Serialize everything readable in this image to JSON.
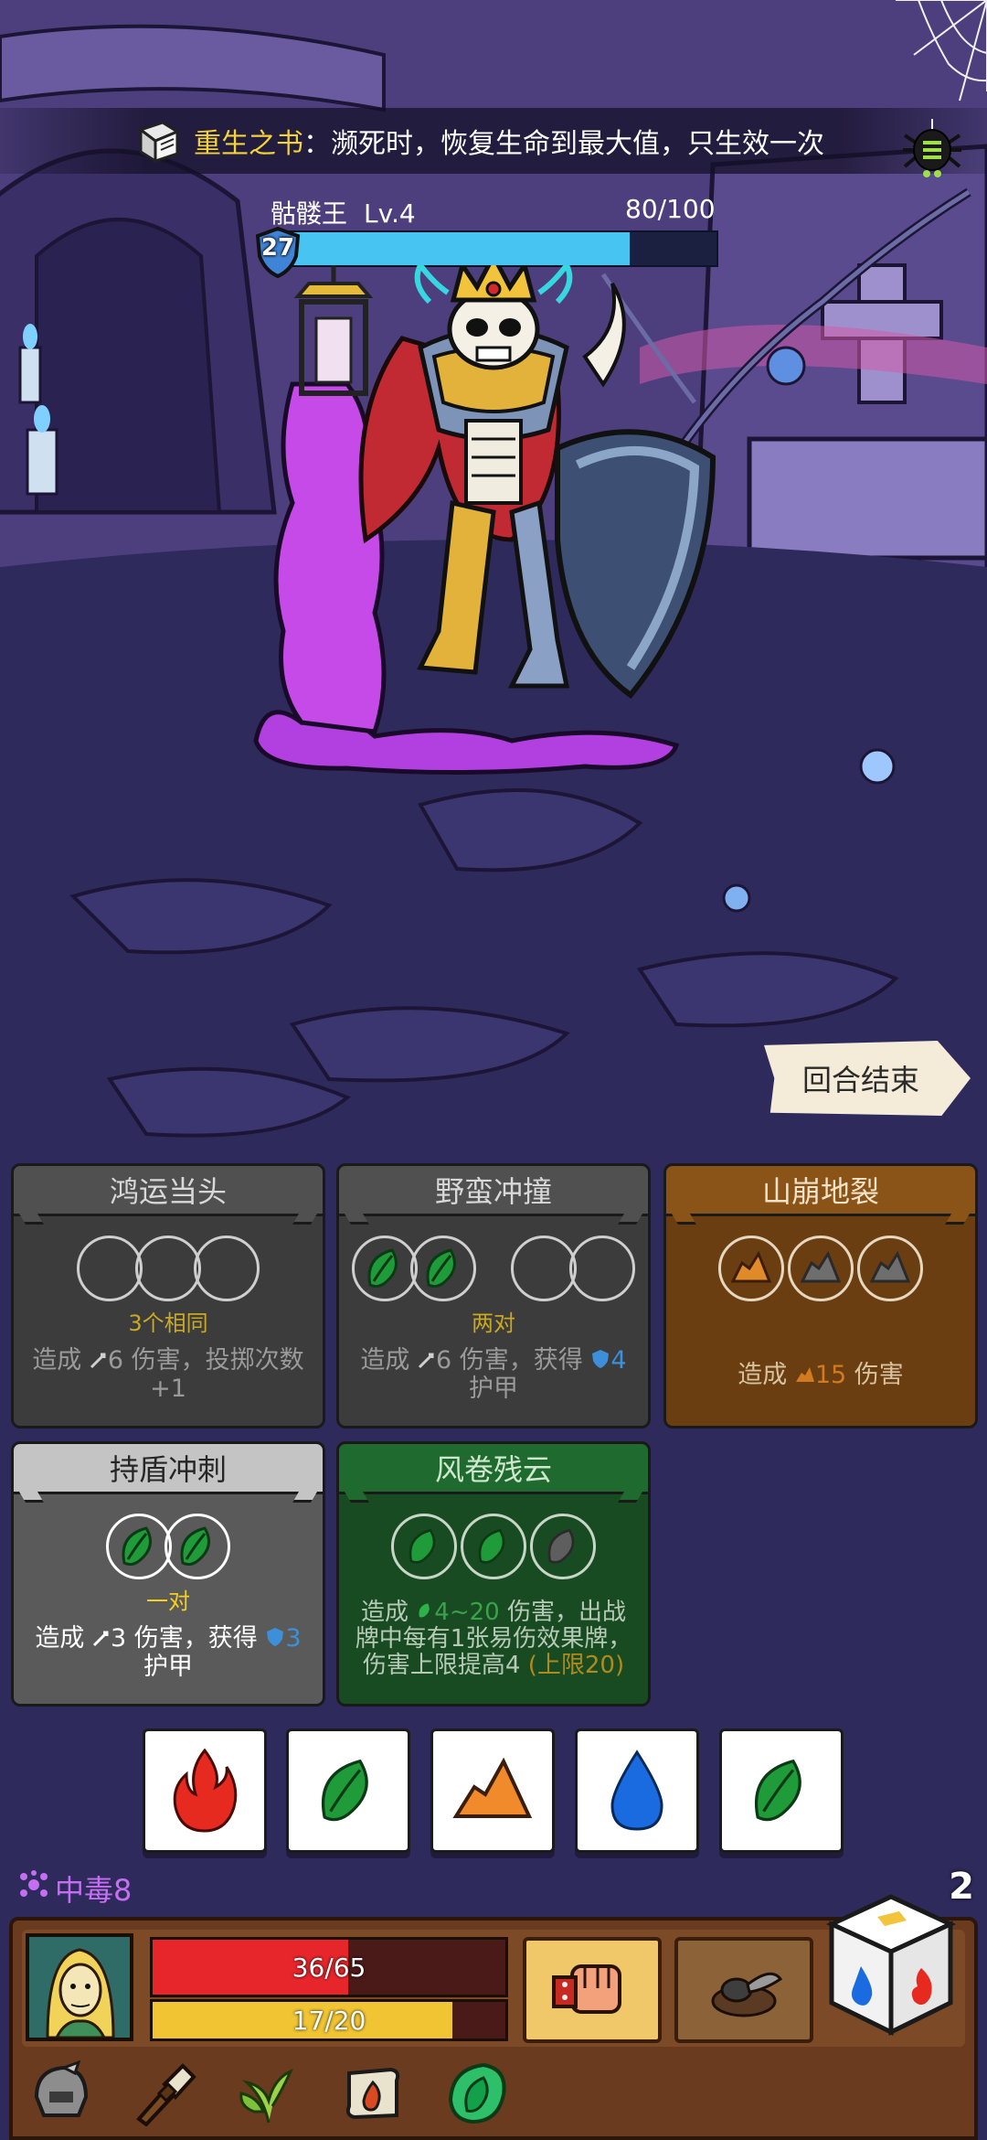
{
  "relic": {
    "icon": "book-icon",
    "name": "重生之书",
    "colon": "：",
    "description": "濒死时，恢复生命到最大值，只生效一次"
  },
  "enemy": {
    "name": "骷髅王",
    "level": "Lv.4",
    "hp_text": "80/100",
    "hp_fraction": 0.8,
    "shield": "27"
  },
  "end_turn_label": "回合结束",
  "cards": [
    {
      "title": "鸿运当头",
      "condition": "3个相同",
      "desc_parts": [
        "造成 ",
        "6",
        " 伤害，投掷次数+1"
      ]
    },
    {
      "title": "野蛮冲撞",
      "condition": "两对",
      "desc_parts": [
        "造成 ",
        "6",
        " 伤害，获得 ",
        "4",
        "护甲"
      ]
    },
    {
      "title": "山崩地裂",
      "desc_parts": [
        "造成 ",
        "15",
        " 伤害"
      ]
    },
    {
      "title": "持盾冲刺",
      "condition": "一对",
      "desc_parts": [
        "造成 ",
        "3",
        " 伤害，获得 ",
        "3",
        "护甲"
      ]
    },
    {
      "title": "风卷残云",
      "desc_parts": [
        "造成 ",
        "4~20",
        " 伤害，出战牌中每有1张易伤效果牌，伤害上限提高4 ",
        "(上限20)"
      ]
    }
  ],
  "dice": [
    "fire",
    "leaf",
    "rock",
    "water",
    "leaf"
  ],
  "status": {
    "poison_label": "中毒8"
  },
  "turn_number": "2",
  "player": {
    "hp_text": "36/65",
    "hp_fraction": 0.554,
    "energy_text": "17/20",
    "energy_fraction": 0.85
  },
  "colors": {
    "accent_yellow": "#f3d23a",
    "hp_red": "#e6262b",
    "energy_yellow": "#f1c433",
    "enemy_hp_blue": "#48c4f3",
    "poison_purple": "#c36ff0"
  },
  "icons": {
    "abilities": [
      "fist-icon",
      "scarab-icon"
    ],
    "relics": [
      "helmet-icon",
      "torch-icon",
      "herb-icon",
      "scroll-fire-icon",
      "leaf-orb-icon"
    ]
  }
}
